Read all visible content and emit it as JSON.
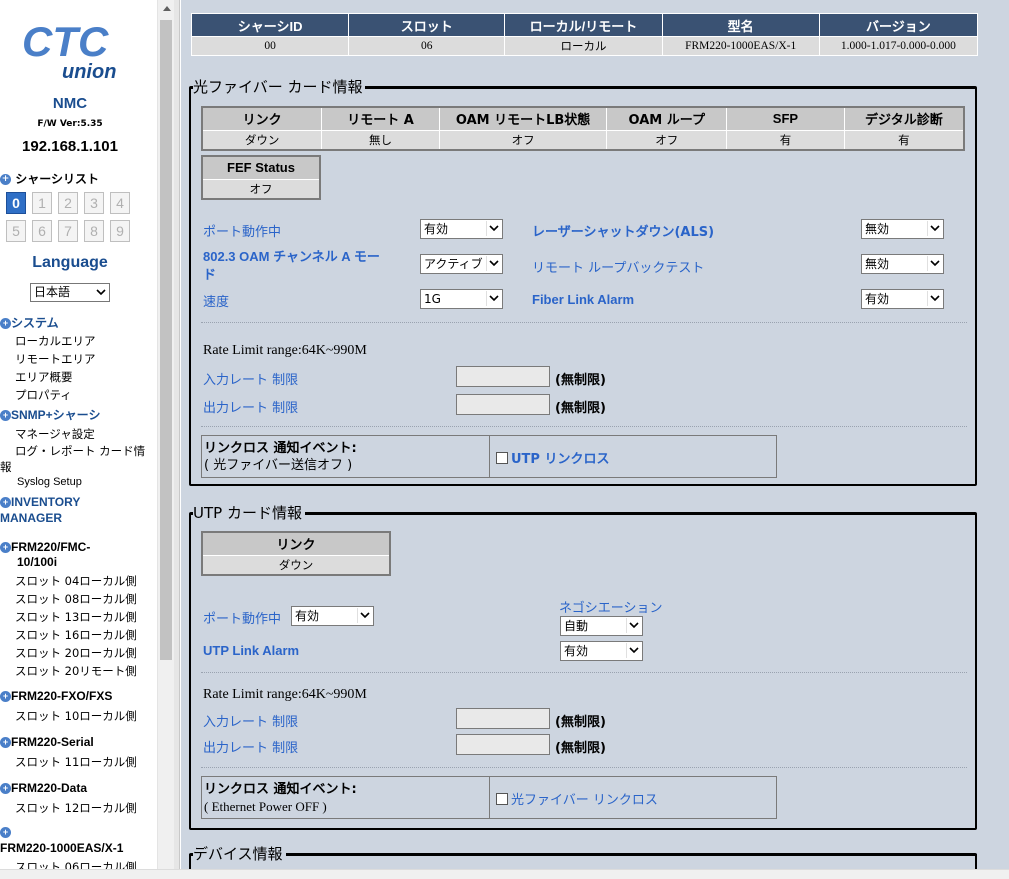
{
  "sidebar": {
    "logo_line1": "CTC",
    "logo_line2": "union",
    "nmc": "NMC",
    "fw": "F/W Ver:5.35",
    "ip": "192.168.1.101",
    "chassis_list": "シャーシリスト",
    "chassis_numbers": [
      "0",
      "1",
      "2",
      "3",
      "4",
      "5",
      "6",
      "7",
      "8",
      "9"
    ],
    "language_title": "Language",
    "language_value": "日本語",
    "system": "システム",
    "system_items": [
      "ローカルエリア",
      "リモートエリア",
      "エリア概要",
      "プロパティ"
    ],
    "snmp": "SNMP+シャーシ",
    "snmp_items": [
      "マネージャ設定",
      "ログ・レポート カード情",
      "報",
      "Syslog Setup"
    ],
    "inventory1": "INVENTORY",
    "inventory2": "MANAGER",
    "dev1_a": "FRM220/FMC-",
    "dev1_b": "10/100i",
    "dev1_items": [
      "スロット 04ローカル側",
      "スロット 08ローカル側",
      "スロット 13ローカル側",
      "スロット 16ローカル側",
      "スロット 20ローカル側",
      "スロット 20リモート側"
    ],
    "dev2": "FRM220-FXO/FXS",
    "dev2_items": [
      "スロット 10ローカル側"
    ],
    "dev3": "FRM220-Serial",
    "dev3_items": [
      "スロット 11ローカル側"
    ],
    "dev4": "FRM220-Data",
    "dev4_items": [
      "スロット 12ローカル側"
    ],
    "dev5": "FRM220-1000EAS/X-1",
    "dev5_items": [
      "スロット 06ローカル側"
    ]
  },
  "chassis_table": {
    "headers": [
      "シャーシID",
      "スロット",
      "ローカル/リモート",
      "型名",
      "バージョン"
    ],
    "row": [
      "00",
      "06",
      "ローカル",
      "FRM220-1000EAS/X-1",
      "1.000-1.017-0.000-0.000"
    ]
  },
  "fiber": {
    "legend": "光ファイバー カード情報",
    "headers": [
      "リンク",
      "リモート A",
      "OAM リモートLB状態",
      "OAM ループ",
      "SFP",
      "デジタル診断"
    ],
    "values": [
      "ダウン",
      "無し",
      "オフ",
      "オフ",
      "有",
      "有"
    ],
    "fef_header": "FEF Status",
    "fef_value": "オフ",
    "port_active_label": "ポート動作中",
    "port_active_value": "有効",
    "oam_label_1": "802.3 OAM チャンネル A モー",
    "oam_label_2": "ド",
    "oam_value": "アクティブ",
    "speed_label": "速度",
    "speed_value": "1G",
    "als_label": "レーザーシャットダウン(ALS)",
    "als_value": "無効",
    "loopback_label": "リモート ループバックテスト",
    "loopback_value": "無効",
    "fiber_alarm_label": "Fiber Link Alarm",
    "fiber_alarm_value": "有効",
    "rate_range": "Rate Limit range:64K~990M",
    "in_rate_label": "入力レート 制限",
    "in_rate_unlimited": "(無制限)",
    "out_rate_label": "出力レート 制限",
    "out_rate_unlimited": "(無制限)",
    "event_title": "リンクロス 通知イベント:",
    "event_sub": "( 光ファイバー送信オフ )",
    "event_check": "UTP リンクロス"
  },
  "utp": {
    "legend": "UTP カード情報",
    "link_header": "リンク",
    "link_value": "ダウン",
    "port_active_label": "ポート動作中",
    "port_active_value": "有効",
    "nego_label": "ネゴシエーション",
    "nego_value": "自動",
    "alarm_label": "UTP Link Alarm",
    "alarm_value": "有効",
    "rate_range": "Rate Limit range:64K~990M",
    "in_rate_label": "入力レート 制限",
    "in_rate_unlimited": "(無制限)",
    "out_rate_label": "出力レート 制限",
    "out_rate_unlimited": "(無制限)",
    "event_title": "リンクロス 通知イベント:",
    "event_sub": "( Ethernet Power OFF )",
    "event_check": "光ファイバー リンクロス"
  },
  "device": {
    "legend": "デバイス情報"
  },
  "colors": {
    "accent_blue": "#2a64c9",
    "header_navy": "#3a5273",
    "panel_bg": "#cdd5e0",
    "active_chassis": "#2f6fc6"
  }
}
